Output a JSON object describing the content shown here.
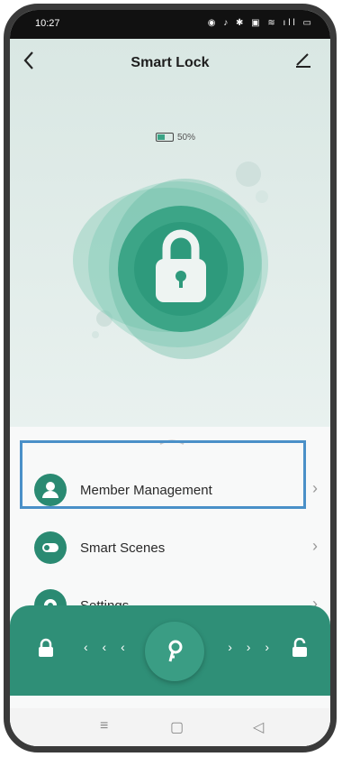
{
  "status_bar": {
    "time": "10:27",
    "icons": "◉ ♪ ✱ ▣ ≋ ıll ▭"
  },
  "header": {
    "title": "Smart Lock"
  },
  "battery": {
    "text": "50%",
    "level": 0.5
  },
  "menu": [
    {
      "label": "Member Management",
      "icon": "person-icon",
      "highlighted": true
    },
    {
      "label": "Smart Scenes",
      "icon": "toggle-icon"
    },
    {
      "label": "Settings",
      "icon": "gear-icon"
    }
  ],
  "action_bar": {
    "left_arrows": "‹ ‹ ‹",
    "right_arrows": "› › ›"
  },
  "navbar": {
    "menu": "≡",
    "home": "▢",
    "back": "◁"
  },
  "colors": {
    "accent": "#2f8f77",
    "highlight": "#4a90c8"
  }
}
